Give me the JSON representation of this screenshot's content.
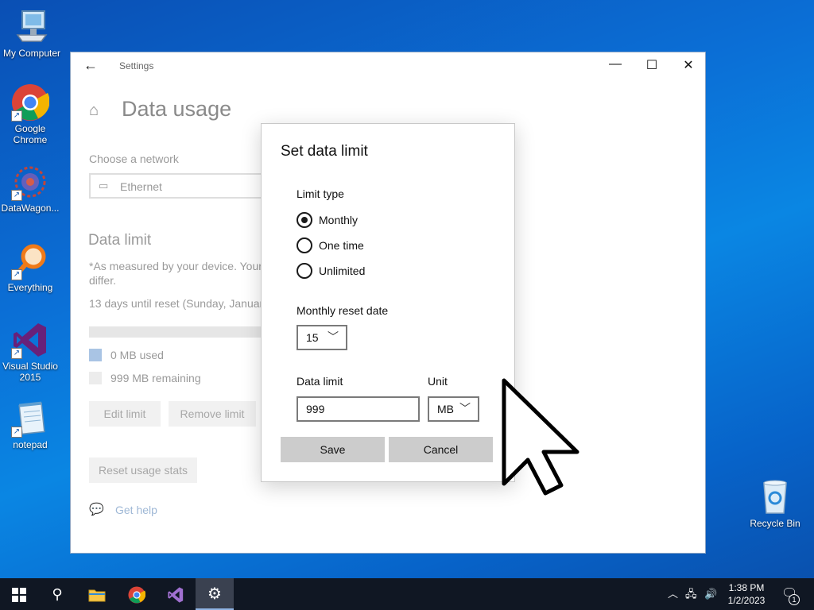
{
  "desktop": {
    "icons": [
      {
        "label": "My Computer"
      },
      {
        "label": "Google Chrome"
      },
      {
        "label": "DataWagon..."
      },
      {
        "label": "Everything"
      },
      {
        "label": "Visual Studio 2015"
      },
      {
        "label": "notepad"
      },
      {
        "label": "Recycle Bin"
      }
    ]
  },
  "window": {
    "app_title": "Settings",
    "back_glyph": "←",
    "minimize_glyph": "—",
    "maximize_glyph": "☐",
    "close_glyph": "✕"
  },
  "page": {
    "title": "Data usage",
    "choose_network_label": "Choose a network",
    "network_value": "Ethernet",
    "data_limit_title": "Data limit",
    "measured_note_1": "*As measured by your device. Your",
    "measured_note_2": "differ.",
    "reset_info": "13 days until reset (Sunday, January",
    "used_text": "0 MB used",
    "remaining_text": "999 MB remaining",
    "edit_limit": "Edit limit",
    "remove_limit": "Remove limit",
    "reset_usage": "Reset usage stats",
    "get_help": "Get help"
  },
  "dialog": {
    "title": "Set data limit",
    "limit_type_label": "Limit type",
    "limit_types": [
      {
        "label": "Monthly",
        "checked": true
      },
      {
        "label": "One time",
        "checked": false
      },
      {
        "label": "Unlimited",
        "checked": false
      }
    ],
    "reset_date_label": "Monthly reset date",
    "reset_date_value": "15",
    "data_limit_label": "Data limit",
    "data_limit_value": "999",
    "unit_label": "Unit",
    "unit_value": "MB",
    "save_label": "Save",
    "cancel_label": "Cancel"
  },
  "taskbar": {
    "time": "1:38 PM",
    "date": "1/2/2023",
    "notification_count": "1"
  },
  "colors": {
    "desktop_blue": "#0b6fd6",
    "taskbar": "#101723",
    "dialog_button": "#cccccc"
  }
}
